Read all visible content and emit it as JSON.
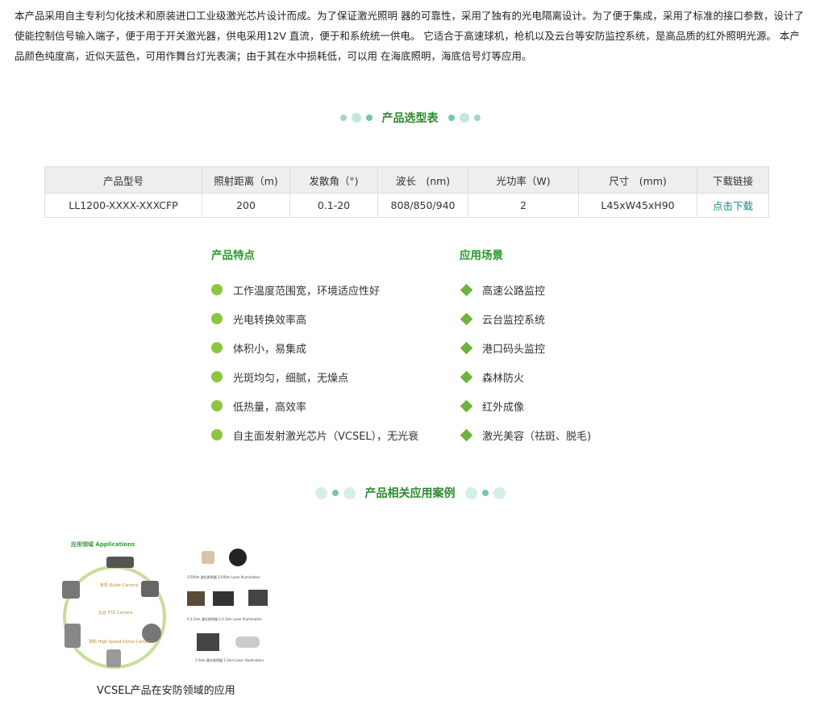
{
  "intro": "本产品采用自主专利匀化技术和原装进口工业级激光芯片设计而成。为了保证激光照明 器的可靠性，采用了独有的光电隔离设计。为了便于集成，采用了标准的接口参数，设计了 使能控制信号输入端子，便于用于开关激光器，供电采用12V 直流，便于和系统统一供电。 它适合于高速球机，枪机以及云台等安防监控系统，是高品质的红外照明光源。 本产品颜色纯度高，近似天蓝色，可用作舞台灯光表演；由于其在水中损耗低，可以用 在海底照明，海底信号灯等应用。",
  "selection_title": "产品选型表",
  "table": {
    "headers": [
      "产品型号",
      "照射距离（m)",
      "发散角（°)",
      "波长　(nm)",
      "光功率（W)",
      "尺寸　(mm)",
      "下载链接"
    ],
    "row": [
      "LL1200-XXXX-XXXCFP",
      "200",
      "0.1-20",
      "808/850/940",
      "2",
      "L45xW45xH90",
      "点击下载"
    ]
  },
  "features": {
    "title": "产品特点",
    "items": [
      "工作温度范围宽，环境适应性好",
      "光电转换效率高",
      "体积小，易集成",
      "光斑均匀，细腻，无燥点",
      "低热量，高效率",
      "自主面发射激光芯片（VCSEL），无光衰"
    ]
  },
  "applications": {
    "title": "应用场景",
    "items": [
      "高速公路监控",
      "云台监控系统",
      "港口码头监控",
      "森林防火",
      "红外成像",
      "激光美容（祛斑、脱毛)"
    ]
  },
  "cases_title": "产品相关应用案例",
  "figure": {
    "heading": "应用领域 Applications",
    "labels": [
      "枪机 Bullet Camera",
      "云台 PTZ Camera",
      "球机 High Speed Dome Camera"
    ],
    "right_labels": [
      "3-500m 激光照明器 3-500m Laser Illuminators",
      "0.3-1km 激光照明器 0.3-1km Laser Illuminators",
      "1-5km 激光照明器 1-5km Laser Illuminators"
    ]
  },
  "caption": "VCSEL产品在安防领域的应用",
  "colors": {
    "accent_green": "#2a8a2a",
    "link": "#1a8a7e",
    "bullet": "#8cc63e"
  }
}
